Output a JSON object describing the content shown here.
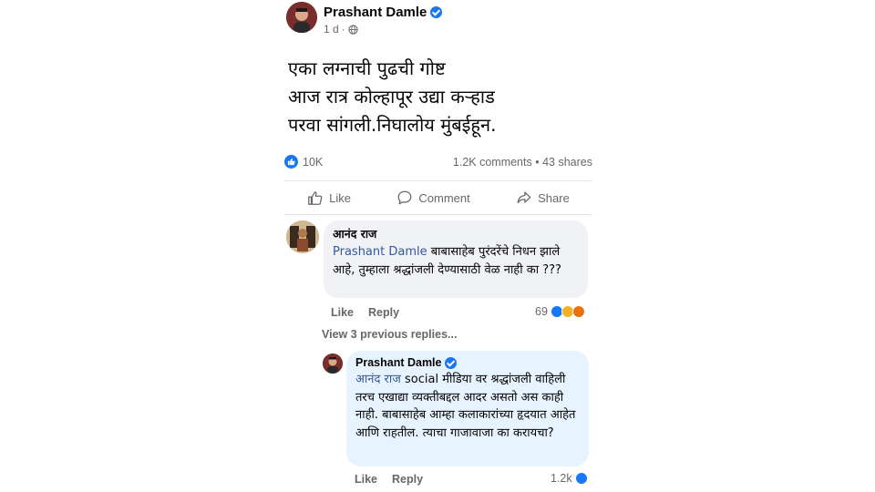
{
  "post": {
    "author": "Prashant Damle",
    "time": "1 d",
    "separator": "·",
    "text_lines": [
      "एका लग्नाची पुढची गोष्ट",
      "आज रात्र कोल्हापूर उद्या कऱ्हाड",
      "परवा सांगली.निघालोय मुंबईहून."
    ],
    "likes": "10K",
    "comments": "1.2K comments",
    "dot": "•",
    "shares": "43 shares"
  },
  "actions": {
    "like": "Like",
    "comment": "Comment",
    "share": "Share"
  },
  "comment1": {
    "author": "आनंद राज",
    "mention": "Prashant Damle",
    "text": " बाबासाहेब पुरंदरेंचे निधन झाले आहे, तुम्हाला श्रद्धांजली देण्यासाठी वेळ नाही का ???",
    "like": "Like",
    "reply": "Reply",
    "reaction_count": "69"
  },
  "view_previous": "View 3 previous replies...",
  "reply1": {
    "author": "Prashant Damle",
    "mention": "आनंद राज",
    "text": " social मीडिया वर श्रद्धांजली वाहिली तरच एखाद्या व्यक्तीबद्दल आदर असतो अस काही नाही. बाबासाहेब आम्हा कलाकारांच्या हृदयात आहेत आणि राहतील. त्याचा गाजावाजा का करायचा?",
    "like": "Like",
    "reply": "Reply",
    "reaction_count": "1.2k"
  },
  "colors": {
    "accent": "#1877f2",
    "mention": "#385898",
    "muted": "#65676b",
    "bubble": "#f0f2f5",
    "reply_bubble": "#e7f3ff"
  }
}
